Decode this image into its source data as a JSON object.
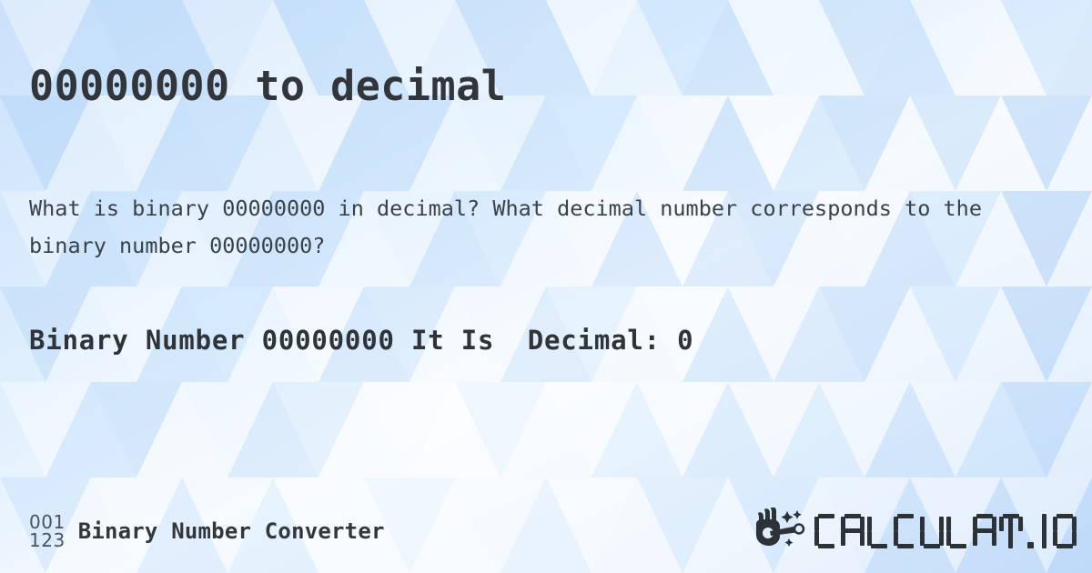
{
  "page": {
    "title": "00000000 to decimal",
    "subtitle": "What is binary 00000000 in decimal? What decimal number corresponds to the binary number 00000000?",
    "result_line": "Binary Number 00000000 It Is  Decimal: 0",
    "binary_number": "00000000",
    "decimal_value": "0"
  },
  "footer": {
    "logo_top_digits": "001",
    "logo_bottom_digits": "123",
    "site_label": "Binary Number Converter",
    "brand_wordmark": "CALCULAT.IO",
    "brand_icon": "hand-magic-wand-icon"
  },
  "colors": {
    "text_dark": "#32363a",
    "text_body": "#3a4149",
    "logo_gray": "#4b535c",
    "background_blue": "#cfe3fb",
    "background_light": "#f7fbff"
  }
}
